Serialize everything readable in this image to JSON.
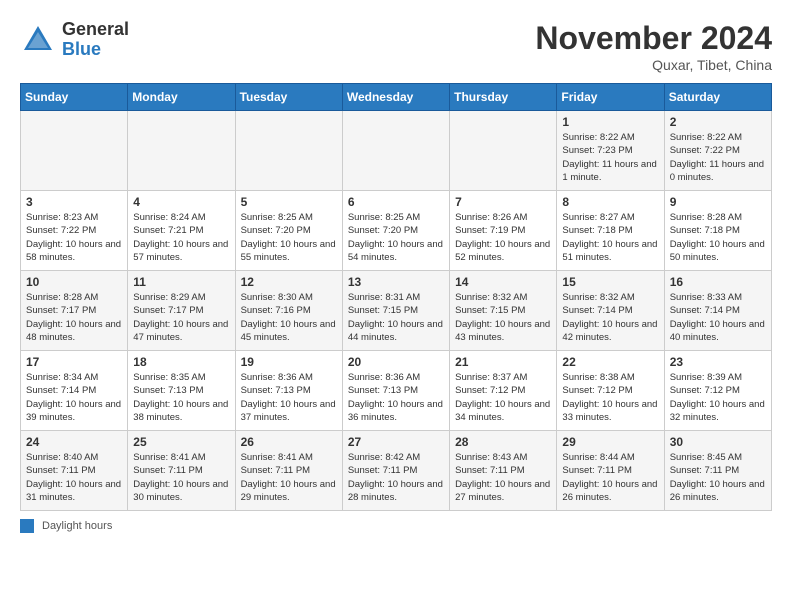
{
  "header": {
    "logo_general": "General",
    "logo_blue": "Blue",
    "month_year": "November 2024",
    "location": "Quxar, Tibet, China"
  },
  "days_of_week": [
    "Sunday",
    "Monday",
    "Tuesday",
    "Wednesday",
    "Thursday",
    "Friday",
    "Saturday"
  ],
  "weeks": [
    [
      {
        "day": "",
        "info": ""
      },
      {
        "day": "",
        "info": ""
      },
      {
        "day": "",
        "info": ""
      },
      {
        "day": "",
        "info": ""
      },
      {
        "day": "",
        "info": ""
      },
      {
        "day": "1",
        "info": "Sunrise: 8:22 AM\nSunset: 7:23 PM\nDaylight: 11 hours and 1 minute."
      },
      {
        "day": "2",
        "info": "Sunrise: 8:22 AM\nSunset: 7:22 PM\nDaylight: 11 hours and 0 minutes."
      }
    ],
    [
      {
        "day": "3",
        "info": "Sunrise: 8:23 AM\nSunset: 7:22 PM\nDaylight: 10 hours and 58 minutes."
      },
      {
        "day": "4",
        "info": "Sunrise: 8:24 AM\nSunset: 7:21 PM\nDaylight: 10 hours and 57 minutes."
      },
      {
        "day": "5",
        "info": "Sunrise: 8:25 AM\nSunset: 7:20 PM\nDaylight: 10 hours and 55 minutes."
      },
      {
        "day": "6",
        "info": "Sunrise: 8:25 AM\nSunset: 7:20 PM\nDaylight: 10 hours and 54 minutes."
      },
      {
        "day": "7",
        "info": "Sunrise: 8:26 AM\nSunset: 7:19 PM\nDaylight: 10 hours and 52 minutes."
      },
      {
        "day": "8",
        "info": "Sunrise: 8:27 AM\nSunset: 7:18 PM\nDaylight: 10 hours and 51 minutes."
      },
      {
        "day": "9",
        "info": "Sunrise: 8:28 AM\nSunset: 7:18 PM\nDaylight: 10 hours and 50 minutes."
      }
    ],
    [
      {
        "day": "10",
        "info": "Sunrise: 8:28 AM\nSunset: 7:17 PM\nDaylight: 10 hours and 48 minutes."
      },
      {
        "day": "11",
        "info": "Sunrise: 8:29 AM\nSunset: 7:17 PM\nDaylight: 10 hours and 47 minutes."
      },
      {
        "day": "12",
        "info": "Sunrise: 8:30 AM\nSunset: 7:16 PM\nDaylight: 10 hours and 45 minutes."
      },
      {
        "day": "13",
        "info": "Sunrise: 8:31 AM\nSunset: 7:15 PM\nDaylight: 10 hours and 44 minutes."
      },
      {
        "day": "14",
        "info": "Sunrise: 8:32 AM\nSunset: 7:15 PM\nDaylight: 10 hours and 43 minutes."
      },
      {
        "day": "15",
        "info": "Sunrise: 8:32 AM\nSunset: 7:14 PM\nDaylight: 10 hours and 42 minutes."
      },
      {
        "day": "16",
        "info": "Sunrise: 8:33 AM\nSunset: 7:14 PM\nDaylight: 10 hours and 40 minutes."
      }
    ],
    [
      {
        "day": "17",
        "info": "Sunrise: 8:34 AM\nSunset: 7:14 PM\nDaylight: 10 hours and 39 minutes."
      },
      {
        "day": "18",
        "info": "Sunrise: 8:35 AM\nSunset: 7:13 PM\nDaylight: 10 hours and 38 minutes."
      },
      {
        "day": "19",
        "info": "Sunrise: 8:36 AM\nSunset: 7:13 PM\nDaylight: 10 hours and 37 minutes."
      },
      {
        "day": "20",
        "info": "Sunrise: 8:36 AM\nSunset: 7:13 PM\nDaylight: 10 hours and 36 minutes."
      },
      {
        "day": "21",
        "info": "Sunrise: 8:37 AM\nSunset: 7:12 PM\nDaylight: 10 hours and 34 minutes."
      },
      {
        "day": "22",
        "info": "Sunrise: 8:38 AM\nSunset: 7:12 PM\nDaylight: 10 hours and 33 minutes."
      },
      {
        "day": "23",
        "info": "Sunrise: 8:39 AM\nSunset: 7:12 PM\nDaylight: 10 hours and 32 minutes."
      }
    ],
    [
      {
        "day": "24",
        "info": "Sunrise: 8:40 AM\nSunset: 7:11 PM\nDaylight: 10 hours and 31 minutes."
      },
      {
        "day": "25",
        "info": "Sunrise: 8:41 AM\nSunset: 7:11 PM\nDaylight: 10 hours and 30 minutes."
      },
      {
        "day": "26",
        "info": "Sunrise: 8:41 AM\nSunset: 7:11 PM\nDaylight: 10 hours and 29 minutes."
      },
      {
        "day": "27",
        "info": "Sunrise: 8:42 AM\nSunset: 7:11 PM\nDaylight: 10 hours and 28 minutes."
      },
      {
        "day": "28",
        "info": "Sunrise: 8:43 AM\nSunset: 7:11 PM\nDaylight: 10 hours and 27 minutes."
      },
      {
        "day": "29",
        "info": "Sunrise: 8:44 AM\nSunset: 7:11 PM\nDaylight: 10 hours and 26 minutes."
      },
      {
        "day": "30",
        "info": "Sunrise: 8:45 AM\nSunset: 7:11 PM\nDaylight: 10 hours and 26 minutes."
      }
    ]
  ],
  "legend": {
    "label": "Daylight hours"
  }
}
